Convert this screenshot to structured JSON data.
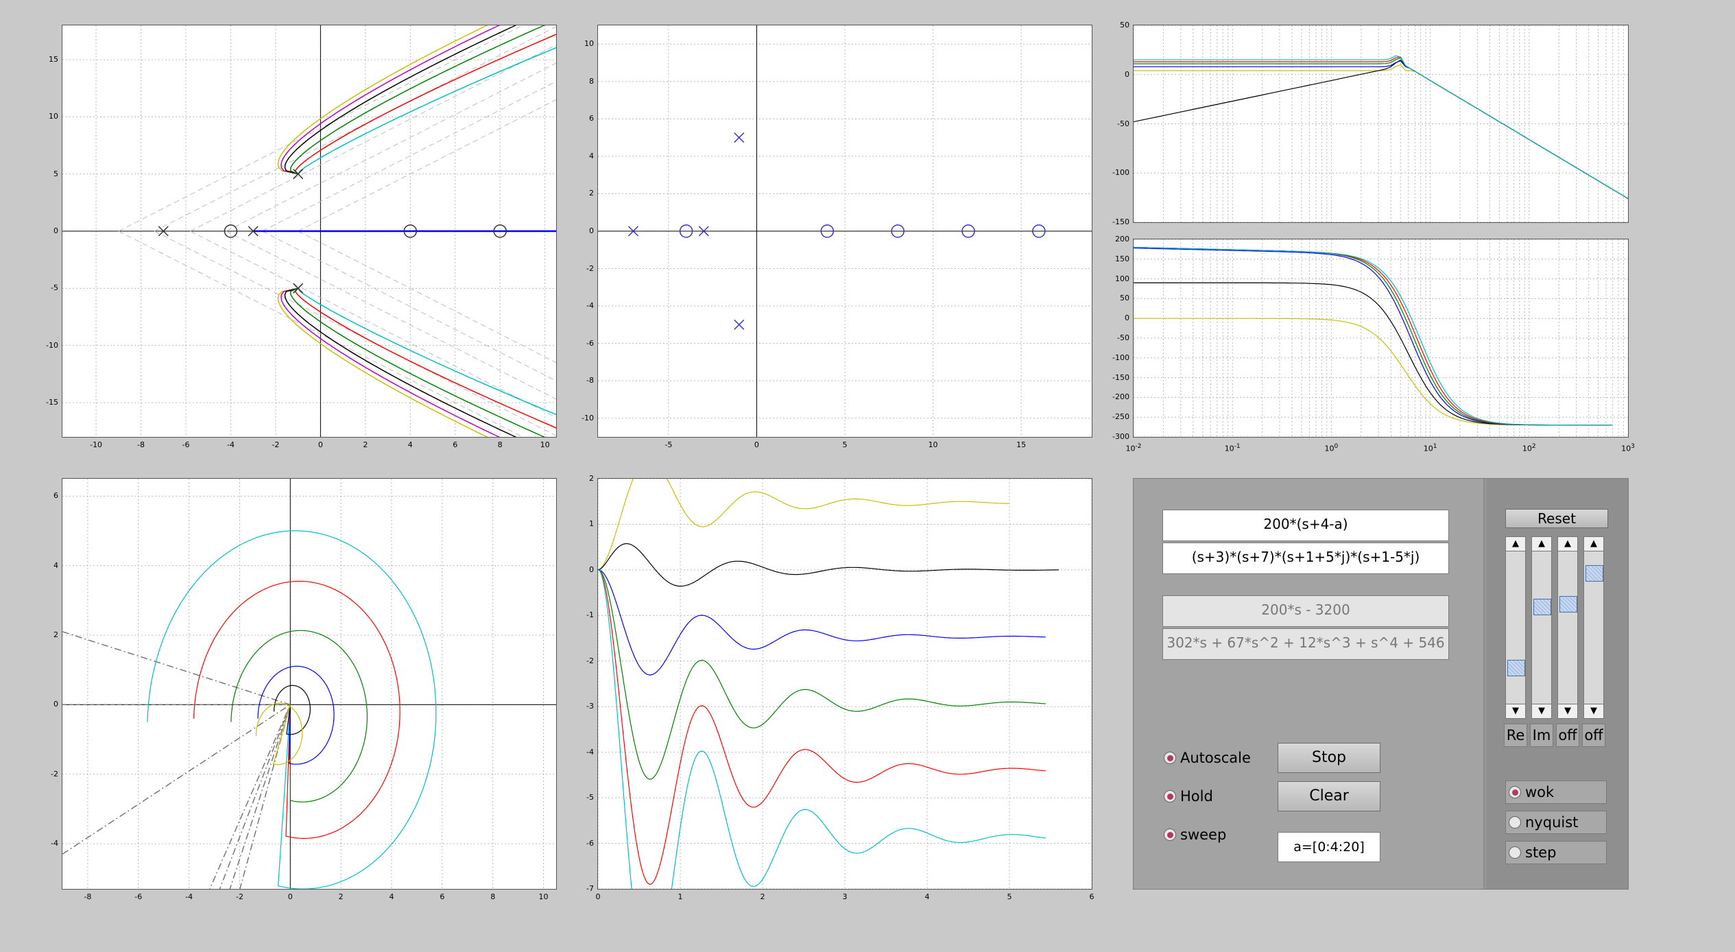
{
  "axes": {
    "rlocus": {
      "xticks": [
        "-10",
        "-8",
        "-6",
        "-4",
        "-2",
        "0",
        "2",
        "4",
        "6",
        "8",
        "10"
      ],
      "yticks": [
        "15",
        "10",
        "5",
        "0",
        "-5",
        "-10",
        "-15"
      ]
    },
    "pzmap": {
      "xticks": [
        "-5",
        "0",
        "5",
        "10",
        "15"
      ],
      "yticks": [
        "10",
        "8",
        "6",
        "4",
        "2",
        "0",
        "-2",
        "-4",
        "-6",
        "-8",
        "-10"
      ]
    },
    "bode_mag": {
      "yticks": [
        "50",
        "0",
        "-50",
        "-100",
        "-150"
      ]
    },
    "bode_phase": {
      "yticks": [
        "200",
        "150",
        "100",
        "50",
        "0",
        "-50",
        "-100",
        "-150",
        "-200",
        "-250",
        "-300"
      ],
      "xticks_base": [
        "10",
        "10",
        "10",
        "10",
        "10",
        "10"
      ],
      "xticks_exp": [
        "-2",
        "-1",
        "0",
        "1",
        "2",
        "3"
      ]
    },
    "nyquist": {
      "xticks": [
        "-8",
        "-6",
        "-4",
        "-2",
        "0",
        "2",
        "4",
        "6",
        "8",
        "10"
      ],
      "yticks": [
        "6",
        "4",
        "2",
        "0",
        "-2",
        "-4"
      ]
    },
    "step": {
      "xticks": [
        "0",
        "1",
        "2",
        "3",
        "4",
        "5",
        "6"
      ],
      "yticks": [
        "2",
        "1",
        "0",
        "-1",
        "-2",
        "-3",
        "-4",
        "-5",
        "-6",
        "-7"
      ]
    }
  },
  "controls": {
    "num_expr": "200*(s+4-a)",
    "den_expr": "(s+3)*(s+7)*(s+1+5*j)*(s+1-5*j)",
    "num_poly": "200*s - 3200",
    "den_poly": "302*s + 67*s^2 + 12*s^3 + s^4 + 546",
    "stop_label": "Stop",
    "clear_label": "Clear",
    "sweep_value": "a=[0:4:20]",
    "autoscale_label": "Autoscale",
    "hold_label": "Hold",
    "sweep_label": "sweep",
    "reset_label": "Reset",
    "slider_labels": [
      "Re",
      "Im",
      "off",
      "off"
    ],
    "slider_levels": [
      0.2,
      0.65,
      0.67,
      0.9
    ],
    "arrow_up": "▲",
    "arrow_down": "▼",
    "modes": [
      "wok",
      "nyquist",
      "step"
    ],
    "selected_mode": "wok"
  },
  "colors": {
    "yellow": "#c8c000",
    "black": "#000000",
    "blue": "#0000ff",
    "green": "#008000",
    "red": "#ff0000",
    "cyan": "#00bfbf",
    "magenta": "#c000c0",
    "radio_on": "#b23a5e"
  },
  "chart_data": [
    {
      "type": "scatter",
      "name_id": "root-locus",
      "xlim": [
        -11.5,
        10.5
      ],
      "ylim": [
        -18,
        18
      ],
      "grid": true,
      "poles": [
        [
          -7,
          0
        ],
        [
          -3,
          0
        ],
        [
          -1,
          5
        ],
        [
          -1,
          -5
        ]
      ],
      "zeros": [
        [
          -4,
          0
        ],
        [
          4,
          0
        ],
        [
          8,
          0
        ]
      ]
    },
    {
      "type": "scatter",
      "name_id": "pole-zero-map",
      "xlim": [
        -9,
        19
      ],
      "ylim": [
        -11,
        11
      ],
      "grid": true,
      "poles": [
        [
          -7,
          0
        ],
        [
          -3,
          0
        ],
        [
          -1,
          5
        ],
        [
          -1,
          -5
        ]
      ],
      "zeros": [
        [
          -4,
          0
        ],
        [
          4,
          0
        ],
        [
          8,
          0
        ],
        [
          12,
          0
        ],
        [
          16,
          0
        ]
      ]
    },
    {
      "type": "line",
      "name_id": "bode-magnitude",
      "xscale": "log",
      "xlim": [
        0.01,
        1000
      ],
      "ylim": [
        -150,
        50
      ],
      "grid": true
    },
    {
      "type": "line",
      "name_id": "bode-phase",
      "xscale": "log",
      "xlim": [
        0.01,
        1000
      ],
      "ylim": [
        -300,
        200
      ],
      "grid": true
    },
    {
      "type": "line",
      "name_id": "nyquist",
      "xlim": [
        -9,
        10.5
      ],
      "ylim": [
        -5.3,
        6.5
      ],
      "grid": true
    },
    {
      "type": "line",
      "name_id": "step-response",
      "xlim": [
        0,
        6
      ],
      "ylim": [
        -7,
        2
      ],
      "grid": true,
      "series": [
        {
          "color": "yellow",
          "steady": 1.47,
          "peak": 1.86
        },
        {
          "color": "black",
          "steady": 0.0,
          "peak": 0.72
        },
        {
          "color": "blue",
          "steady": -1.47,
          "peak": -1.75
        },
        {
          "color": "green",
          "steady": -2.93,
          "peak": -3.35
        },
        {
          "color": "red",
          "steady": -4.4,
          "peak": -4.95
        },
        {
          "color": "cyan",
          "steady": -5.87,
          "peak": -6.5
        }
      ]
    }
  ]
}
